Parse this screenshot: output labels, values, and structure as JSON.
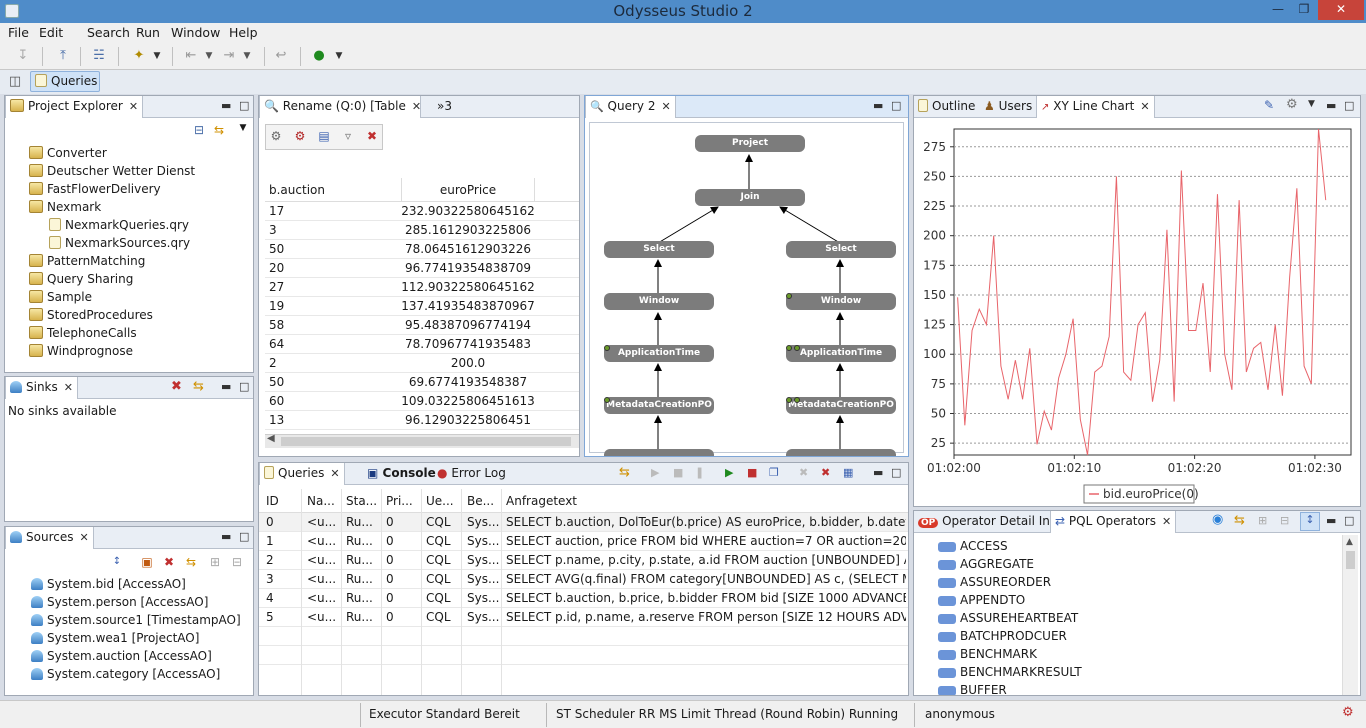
{
  "app": {
    "title": "Odysseus Studio 2"
  },
  "menu": [
    "File",
    "Edit",
    "Search",
    "Run",
    "Window",
    "Help"
  ],
  "perspective": {
    "label": "Queries"
  },
  "project_explorer": {
    "tab": "Project Explorer",
    "items": [
      {
        "label": "Converter",
        "type": "project"
      },
      {
        "label": "Deutscher Wetter Dienst",
        "type": "project"
      },
      {
        "label": "FastFlowerDelivery",
        "type": "project"
      },
      {
        "label": "Nexmark",
        "type": "project"
      },
      {
        "label": "NexmarkQueries.qry",
        "type": "file"
      },
      {
        "label": "NexmarkSources.qry",
        "type": "file"
      },
      {
        "label": "PatternMatching",
        "type": "project"
      },
      {
        "label": "Query Sharing",
        "type": "project"
      },
      {
        "label": "Sample",
        "type": "project"
      },
      {
        "label": "StoredProcedures",
        "type": "project"
      },
      {
        "label": "TelephoneCalls",
        "type": "project"
      },
      {
        "label": "Windprognose",
        "type": "project"
      }
    ]
  },
  "sinks": {
    "tab": "Sinks",
    "empty": "No sinks available"
  },
  "sources": {
    "tab": "Sources",
    "items": [
      "System.bid [AccessAO]",
      "System.person [AccessAO]",
      "System.source1 [TimestampAO]",
      "System.wea1 [ProjectAO]",
      "System.auction [AccessAO]",
      "System.category [AccessAO]"
    ]
  },
  "rename_table": {
    "tab": "Rename (Q:0) [Table",
    "overflow": "»3",
    "columns": [
      "b.auction",
      "euroPrice"
    ],
    "rows": [
      [
        "17",
        "232.90322580645162"
      ],
      [
        "3",
        "285.1612903225806"
      ],
      [
        "50",
        "78.06451612903226"
      ],
      [
        "20",
        "96.77419354838709"
      ],
      [
        "27",
        "112.90322580645162"
      ],
      [
        "19",
        "137.41935483870967"
      ],
      [
        "58",
        "95.48387096774194"
      ],
      [
        "64",
        "78.70967741935483"
      ],
      [
        "2",
        "200.0"
      ],
      [
        "50",
        "69.6774193548387"
      ],
      [
        "60",
        "109.03225806451613"
      ],
      [
        "13",
        "96.12903225806451"
      ]
    ]
  },
  "query_graph": {
    "tab": "Query 2",
    "nodes": {
      "project": "Project",
      "join": "Join",
      "select_l": "Select",
      "select_r": "Select",
      "window_l": "Window",
      "window_r": "Window",
      "apptime_l": "ApplicationTime",
      "apptime_r": "ApplicationTime",
      "meta_l": "MetadataCreationPO",
      "meta_r": "MetadataCreationPO"
    }
  },
  "right_tabs": {
    "outline": "Outline",
    "users": "Users",
    "chart": "XY Line Chart"
  },
  "chart_data": {
    "type": "line",
    "title": "",
    "xlabel": "",
    "ylabel": "",
    "y_ticks": [
      25,
      50,
      75,
      100,
      125,
      150,
      175,
      200,
      225,
      250,
      275
    ],
    "x_ticks": [
      "01:02:00",
      "01:02:10",
      "01:02:20",
      "01:02:30"
    ],
    "ylim": [
      15,
      290
    ],
    "grid": true,
    "legend_position": "bottom",
    "color": "#e8646a",
    "series": [
      {
        "name": "bid.euroPrice(0)",
        "x": [
          0,
          0.6,
          1.2,
          1.8,
          2.4,
          3.0,
          3.6,
          4.2,
          4.8,
          5.4,
          6.0,
          6.6,
          7.2,
          7.8,
          8.4,
          9.0,
          9.6,
          10.2,
          10.8,
          11.4,
          12.0,
          12.6,
          13.2,
          13.8,
          14.4,
          15.0,
          15.6,
          16.2,
          16.8,
          17.4,
          18.0,
          18.6,
          19.2,
          19.8,
          20.4,
          21.0,
          21.6,
          22.2,
          22.8,
          23.4,
          24.0,
          24.6,
          25.2,
          25.8,
          26.4,
          27.0,
          27.6,
          28.2,
          28.8,
          29.4,
          30.0,
          30.6
        ],
        "y": [
          148,
          40,
          120,
          138,
          125,
          200,
          90,
          62,
          95,
          62,
          105,
          24,
          52,
          36,
          80,
          100,
          130,
          45,
          15,
          85,
          90,
          115,
          250,
          85,
          78,
          125,
          135,
          60,
          95,
          205,
          60,
          255,
          120,
          120,
          160,
          85,
          235,
          100,
          70,
          230,
          85,
          105,
          110,
          70,
          125,
          65,
          165,
          240,
          90,
          75,
          290,
          230
        ]
      }
    ]
  },
  "queries_panel": {
    "tabs": [
      "Queries",
      "Console",
      "Error Log"
    ],
    "columns": [
      "ID",
      "Na...",
      "Sta...",
      "Pri...",
      "Ue...",
      "Be...",
      "Anfragetext"
    ],
    "rows": [
      [
        "0",
        "<u...",
        "Ru...",
        "0",
        "CQL",
        "Sys...",
        "SELECT b.auction, DolToEur(b.price) AS euroPrice, b.bidder, b.datetime ..."
      ],
      [
        "1",
        "<u...",
        "Ru...",
        "0",
        "CQL",
        "Sys...",
        "SELECT auction, price FROM bid WHERE auction=7 OR auction=20 OR a..."
      ],
      [
        "2",
        "<u...",
        "Ru...",
        "0",
        "CQL",
        "Sys...",
        "SELECT p.name, p.city, p.state, a.id FROM auction [UNBOUNDED] AS a, ..."
      ],
      [
        "3",
        "<u...",
        "Ru...",
        "0",
        "CQL",
        "Sys...",
        "SELECT AVG(q.final) FROM category[UNBOUNDED] AS c, (SELECT MAX(..."
      ],
      [
        "4",
        "<u...",
        "Ru...",
        "0",
        "CQL",
        "Sys...",
        "SELECT b.auction, b.price, b.bidder FROM bid [SIZE 1000 ADVANCE 1000..."
      ],
      [
        "5",
        "<u...",
        "Ru...",
        "0",
        "CQL",
        "Sys...",
        "SELECT p.id, p.name, a.reserve FROM person [SIZE 12 HOURS ADVANCE..."
      ]
    ]
  },
  "operators_panel": {
    "tabs": [
      "Operator Detail Info",
      "PQL Operators"
    ],
    "badge": "OP",
    "items": [
      "ACCESS",
      "AGGREGATE",
      "ASSUREORDER",
      "APPENDTO",
      "ASSUREHEARTBEAT",
      "BATCHPRODCUER",
      "BENCHMARK",
      "BENCHMARKRESULT",
      "BUFFER"
    ]
  },
  "status": {
    "executor": "Executor Standard Bereit",
    "scheduler": "ST Scheduler RR MS Limit Thread (Round Robin) Running",
    "user": "anonymous"
  }
}
